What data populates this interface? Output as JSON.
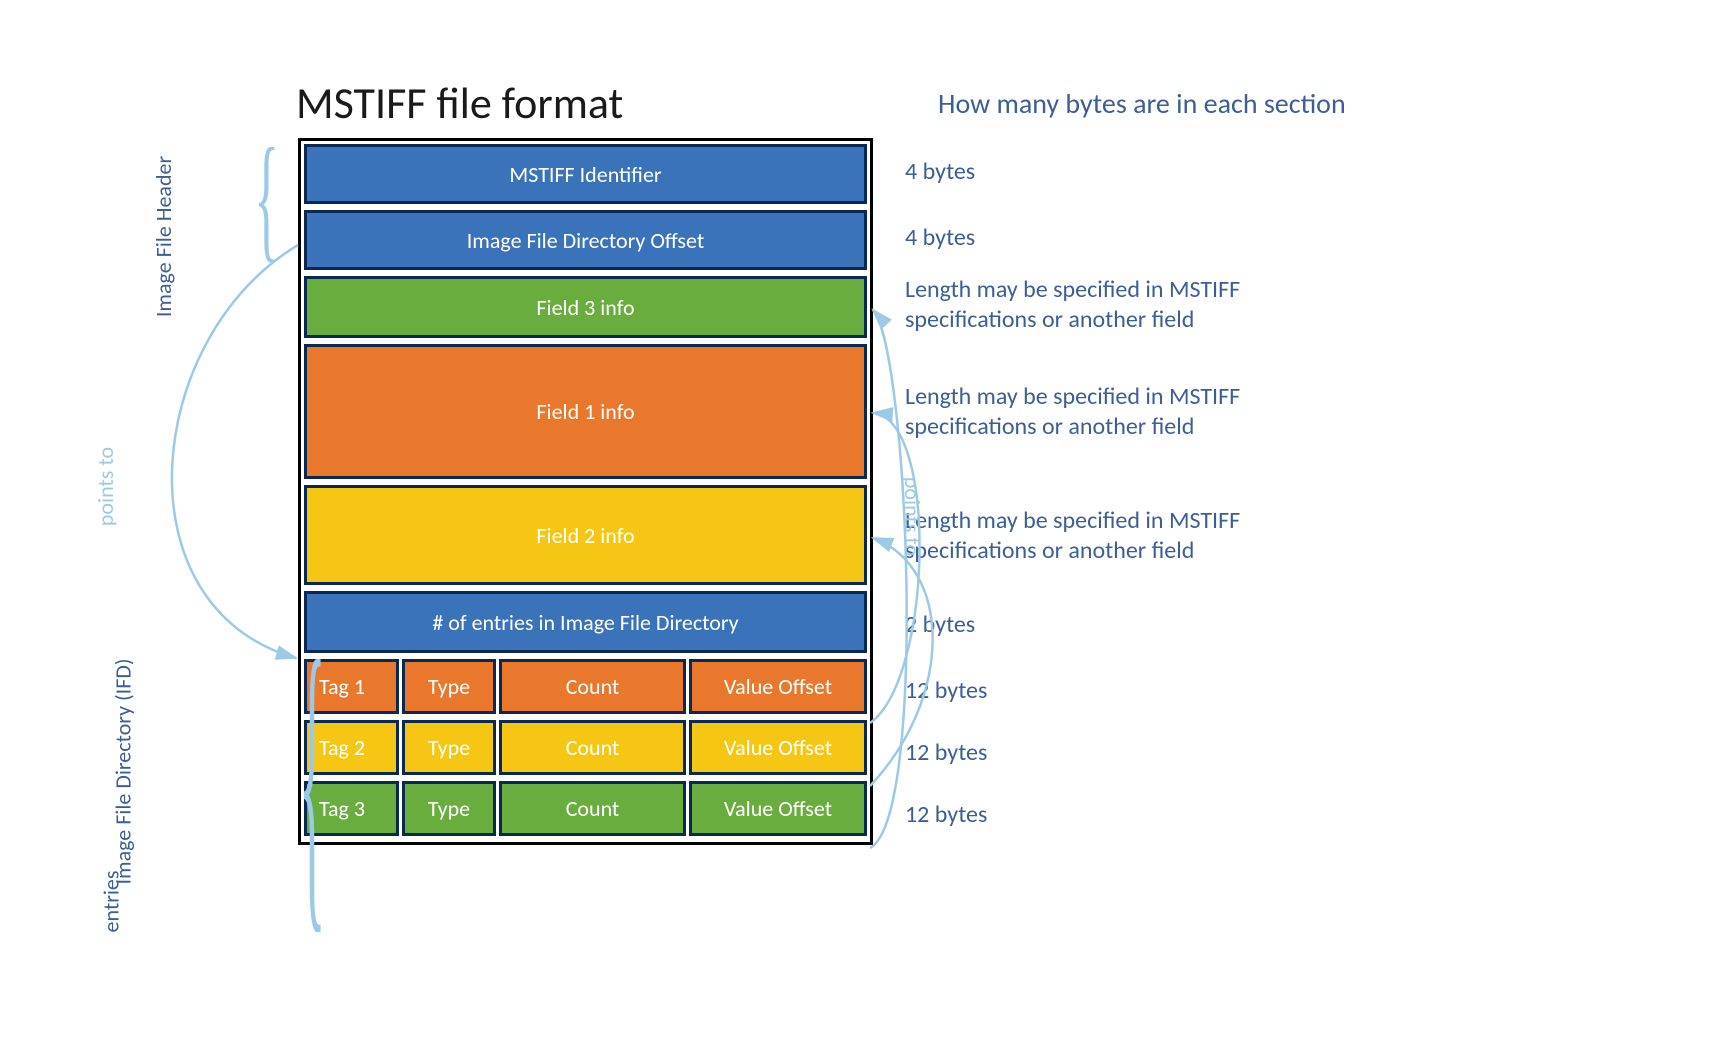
{
  "title": "MSTIFF file format",
  "bytesHeader": "How many bytes are in each section",
  "leftLabels": {
    "header": "Image File Header",
    "pointsTo": "points to",
    "ifdLine1": "Image File Directory (IFD)",
    "ifdLine2": "entries"
  },
  "rightPointsTo": "points to",
  "blocks": {
    "identifier": "MSTIFF Identifier",
    "ifdOffset": "Image File Directory Offset",
    "field3": "Field 3 info",
    "field1": "Field 1 info",
    "field2": "Field 2 info",
    "numEntries": "# of entries in Image File Directory"
  },
  "rows": [
    {
      "tag": "Tag 1",
      "type": "Type",
      "count": "Count",
      "offset": "Value Offset"
    },
    {
      "tag": "Tag 2",
      "type": "Type",
      "count": "Count",
      "offset": "Value Offset"
    },
    {
      "tag": "Tag 3",
      "type": "Type",
      "count": "Count",
      "offset": "Value Offset"
    }
  ],
  "annotations": {
    "identifier": "4 bytes",
    "ifdOffset": "4 bytes",
    "field3": "Length may be specified in MSTIFF specifications or another field",
    "field1": "Length may be specified in MSTIFF specifications or another field",
    "field2": "Length may be specified in MSTIFF specifications or another field",
    "numEntries": "2 bytes",
    "row1": "12 bytes",
    "row2": "12 bytes",
    "row3": "12 bytes"
  },
  "colors": {
    "blue": "#3a73ba",
    "green": "#6aad3f",
    "orange": "#e9782d",
    "yellow": "#f6c614",
    "textBlue": "#3c5e95",
    "arrowBlue": "#9ec9e6"
  }
}
